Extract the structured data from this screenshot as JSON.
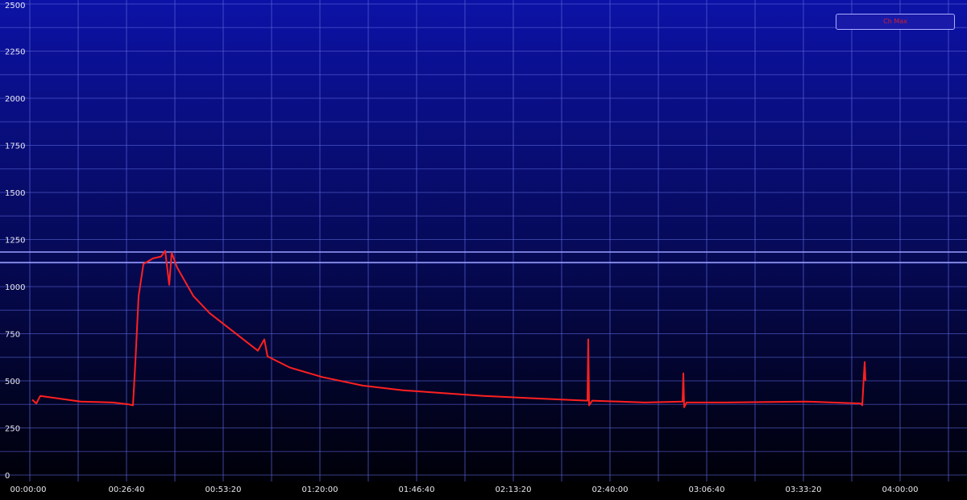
{
  "chart_data": {
    "type": "line",
    "title": "",
    "xlabel": "",
    "ylabel": "",
    "xlim": [
      0,
      15507
    ],
    "ylim": [
      0,
      2500
    ],
    "grid": true,
    "x_unit": "seconds",
    "x_ticks": [
      0,
      1600,
      3200,
      4800,
      6400,
      8000,
      9600,
      11200,
      12800,
      14400
    ],
    "x_tick_labels": [
      "00:00:00",
      "00:26:40",
      "00:53:20",
      "01:20:00",
      "01:46:40",
      "02:13:20",
      "02:40:00",
      "03:06:40",
      "03:33:20",
      "04:00:00"
    ],
    "y_ticks": [
      0,
      250,
      500,
      750,
      1000,
      1250,
      1500,
      1750,
      2000,
      2250,
      2500
    ],
    "y_tick_labels": [
      "0",
      "250",
      "500",
      "750",
      "1000",
      "1250",
      "1500",
      "1750",
      "2000",
      "2250",
      "2500"
    ],
    "reference_lines": [
      1184,
      1128
    ],
    "legend": {
      "placement": "top-right",
      "label": "Ch Max"
    },
    "colors": {
      "series": "#ff2020",
      "grid": "#5a63d8",
      "reference": "#9aa0ff"
    },
    "series": [
      {
        "name": "Ch Max",
        "x": [
          40,
          107,
          173,
          840,
          1373,
          1640,
          1707,
          1747,
          1800,
          1880,
          2040,
          2173,
          2240,
          2307,
          2347,
          2440,
          2707,
          2973,
          3373,
          3773,
          3880,
          3933,
          4307,
          4840,
          5507,
          6173,
          6840,
          7507,
          8173,
          8840,
          9227,
          9240,
          9253,
          9307,
          10173,
          10800,
          10813,
          10827,
          10867,
          11507,
          12840,
          13747,
          13773,
          13813,
          13827
        ],
        "y": [
          400,
          380,
          420,
          390,
          385,
          375,
          370,
          600,
          950,
          1120,
          1150,
          1160,
          1190,
          1010,
          1180,
          1100,
          950,
          860,
          760,
          660,
          720,
          630,
          570,
          520,
          475,
          450,
          435,
          420,
          410,
          400,
          395,
          720,
          370,
          395,
          385,
          390,
          540,
          360,
          385,
          385,
          390,
          380,
          370,
          600,
          500
        ]
      }
    ]
  }
}
